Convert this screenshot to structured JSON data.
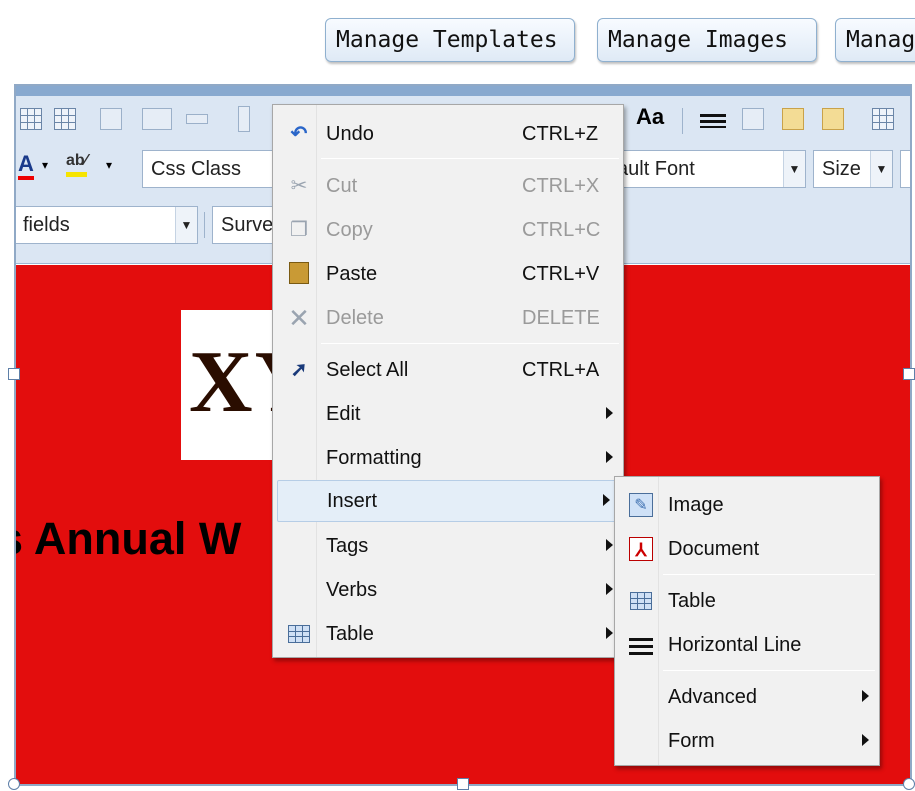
{
  "header": {
    "buttons": [
      {
        "label": "Manage Templates"
      },
      {
        "label": "Manage Images"
      },
      {
        "label": "Manage"
      }
    ]
  },
  "toolbar": {
    "css_class": "Css Class",
    "font": "ault Font",
    "size": "Size",
    "fields": "fields",
    "survey": "Surve",
    "font_color_icon": "font-color-icon",
    "highlight_icon": "highlight-color-icon"
  },
  "canvas": {
    "background": "#e30d0d",
    "logo_text": "XY",
    "headline": "s Annual W"
  },
  "context_menu": {
    "items": [
      {
        "label": "Undo",
        "shortcut": "CTRL+Z",
        "icon": "undo-icon",
        "enabled": true
      },
      {
        "label": "Cut",
        "shortcut": "CTRL+X",
        "icon": "cut-icon",
        "enabled": false
      },
      {
        "label": "Copy",
        "shortcut": "CTRL+C",
        "icon": "copy-icon",
        "enabled": false
      },
      {
        "label": "Paste",
        "shortcut": "CTRL+V",
        "icon": "paste-icon",
        "enabled": true
      },
      {
        "label": "Delete",
        "shortcut": "DELETE",
        "icon": "delete-icon",
        "enabled": false
      },
      {
        "label": "Select All",
        "shortcut": "CTRL+A",
        "icon": "select-all-icon",
        "enabled": true
      },
      {
        "label": "Edit",
        "submenu": true
      },
      {
        "label": "Formatting",
        "submenu": true
      },
      {
        "label": "Insert",
        "submenu": true,
        "highlighted": true
      },
      {
        "label": "Tags",
        "submenu": true
      },
      {
        "label": "Verbs",
        "submenu": true
      },
      {
        "label": "Table",
        "submenu": true,
        "icon": "table-icon"
      }
    ]
  },
  "insert_submenu": {
    "items": [
      {
        "label": "Image",
        "icon": "image-icon"
      },
      {
        "label": "Document",
        "icon": "pdf-document-icon"
      },
      {
        "label": "Table",
        "icon": "table-icon"
      },
      {
        "label": "Horizontal Line",
        "icon": "horizontal-line-icon"
      },
      {
        "label": "Advanced",
        "submenu": true
      },
      {
        "label": "Form",
        "submenu": true
      }
    ]
  }
}
